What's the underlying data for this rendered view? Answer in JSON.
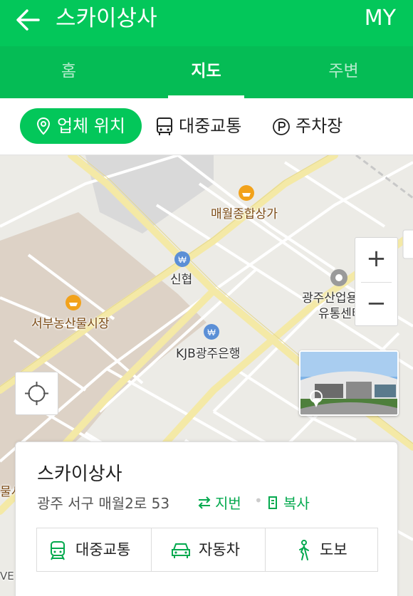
{
  "header": {
    "title": "스카이상사",
    "right_label": "MY"
  },
  "tabs": [
    {
      "label": "홈"
    },
    {
      "label": "지도"
    },
    {
      "label": "주변"
    }
  ],
  "filters": [
    {
      "label": "업체 위치",
      "icon": "location-pin-icon"
    },
    {
      "label": "대중교통",
      "icon": "bus-icon"
    },
    {
      "label": "주차장",
      "icon": "parking-icon"
    }
  ],
  "map": {
    "pois": [
      {
        "label": "매월종합상가",
        "icon": "shopping-icon"
      },
      {
        "label": "신협",
        "icon": "bank-icon"
      },
      {
        "label": "광주산업용재",
        "icon": "place-icon"
      },
      {
        "label": "유통센터"
      },
      {
        "label": "서부농산물시장",
        "icon": "shopping-icon"
      },
      {
        "label": "KJB광주은행",
        "icon": "bank-icon"
      },
      {
        "label": "물시"
      }
    ],
    "zoom_in": "+",
    "zoom_out": "−",
    "watermark": "VE"
  },
  "card": {
    "title": "스카이상사",
    "address": "광주 서구 매월2로 53",
    "jibun_label": "지번",
    "copy_label": "복사",
    "separator": "•",
    "transport": [
      {
        "label": "대중교통",
        "icon": "train-icon"
      },
      {
        "label": "자동차",
        "icon": "car-icon"
      },
      {
        "label": "도보",
        "icon": "walk-icon"
      }
    ]
  },
  "colors": {
    "brand": "#03c75a",
    "link": "#03a94e"
  }
}
